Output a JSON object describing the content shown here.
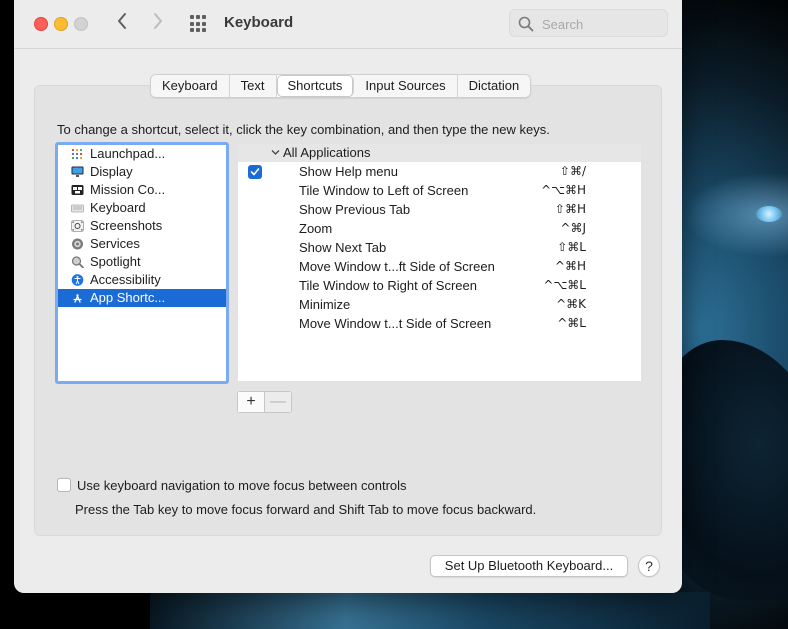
{
  "window": {
    "title": "Keyboard"
  },
  "search": {
    "placeholder": "Search"
  },
  "tabs": [
    {
      "label": "Keyboard",
      "active": false
    },
    {
      "label": "Text",
      "active": false
    },
    {
      "label": "Shortcuts",
      "active": true
    },
    {
      "label": "Input Sources",
      "active": false
    },
    {
      "label": "Dictation",
      "active": false
    }
  ],
  "instruction": "To change a shortcut, select it, click the key combination, and then type the new keys.",
  "categories": [
    {
      "label": "Launchpad...",
      "icon": "launchpad-icon",
      "selected": false
    },
    {
      "label": "Display",
      "icon": "display-icon",
      "selected": false
    },
    {
      "label": "Mission Co...",
      "icon": "mission-control-icon",
      "selected": false
    },
    {
      "label": "Keyboard",
      "icon": "keyboard-icon",
      "selected": false
    },
    {
      "label": "Screenshots",
      "icon": "screenshots-icon",
      "selected": false
    },
    {
      "label": "Services",
      "icon": "services-gear-icon",
      "selected": false
    },
    {
      "label": "Spotlight",
      "icon": "spotlight-icon",
      "selected": false
    },
    {
      "label": "Accessibility",
      "icon": "accessibility-icon",
      "selected": false
    },
    {
      "label": "App Shortc...",
      "icon": "app-store-icon",
      "selected": true
    }
  ],
  "shortcut_group": {
    "label": "All Applications",
    "checked": true
  },
  "shortcuts": [
    {
      "name": "Show Help menu",
      "keys": "⇧⌘/"
    },
    {
      "name": "Tile Window to Left of Screen",
      "keys": "^⌥⌘H"
    },
    {
      "name": "Show Previous Tab",
      "keys": "⇧⌘H"
    },
    {
      "name": "Zoom",
      "keys": "^⌘J"
    },
    {
      "name": "Show Next Tab",
      "keys": "⇧⌘L"
    },
    {
      "name": "Move Window t...ft Side of Screen",
      "keys": "^⌘H"
    },
    {
      "name": "Tile Window to Right of Screen",
      "keys": "^⌥⌘L"
    },
    {
      "name": "Minimize",
      "keys": "^⌘K"
    },
    {
      "name": "Move Window t...t Side of Screen",
      "keys": "^⌘L"
    }
  ],
  "buttons": {
    "add": "+",
    "remove": "—",
    "bluetooth": "Set Up Bluetooth Keyboard...",
    "help": "?"
  },
  "keyboard_nav": {
    "label": "Use keyboard navigation to move focus between controls",
    "checked": false,
    "help": "Press the Tab key to move focus forward and Shift Tab to move focus backward."
  }
}
